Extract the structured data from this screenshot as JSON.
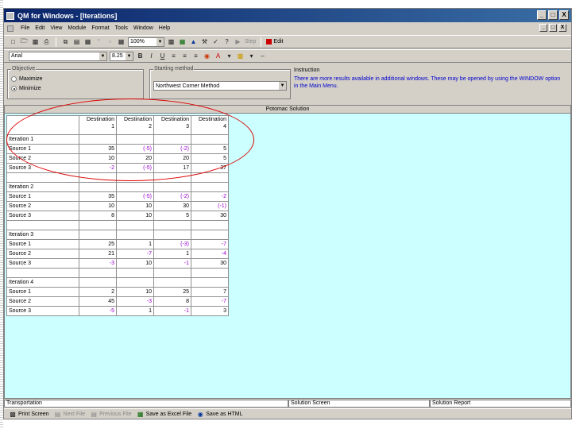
{
  "window": {
    "title": "QM for Windows - [Iterations]",
    "controls": [
      "_",
      "□",
      "X"
    ],
    "mdi_controls": [
      "_",
      "□",
      "X"
    ]
  },
  "menu": [
    "File",
    "Edit",
    "View",
    "Module",
    "Format",
    "Tools",
    "Window",
    "Help"
  ],
  "toolbar1": {
    "zoom_value": "100%",
    "step_label": "Step",
    "edit_label": "Edit"
  },
  "toolbar2": {
    "font_name": "Arial",
    "font_size": "8.25"
  },
  "options": {
    "objective_legend": "Objective",
    "maximize_label": "Maximize",
    "minimize_label": "Minimize",
    "selected_objective": "Minimize",
    "starting_method_legend": "Starting method",
    "starting_method_value": "Northwest Corner Method",
    "instruction_label": "Instruction",
    "instruction_text": "There are more results available in additional windows. These may be opened by using the WINDOW option in the Main Menu."
  },
  "grid": {
    "title": "Potomac Solution",
    "columns": [
      {
        "line1": "Destination",
        "line2": "1"
      },
      {
        "line1": "Destination",
        "line2": "2"
      },
      {
        "line1": "Destination",
        "line2": "3"
      },
      {
        "line1": "Destination",
        "line2": "4"
      }
    ],
    "iterations": [
      {
        "label": "Iteration 1",
        "rows": [
          {
            "label": "Source 1",
            "values": [
              "35",
              "(-5)",
              "(-2)",
              "5"
            ]
          },
          {
            "label": "Source 2",
            "values": [
              "10",
              "20",
              "20",
              "5"
            ]
          },
          {
            "label": "Source 3",
            "values": [
              "-2",
              "(-5)",
              "17",
              "37"
            ]
          }
        ]
      },
      {
        "label": "Iteration 2",
        "rows": [
          {
            "label": "Source 1",
            "values": [
              "35",
              "(-5)",
              "(-2)",
              "-2"
            ]
          },
          {
            "label": "Source 2",
            "values": [
              "10",
              "10",
              "30",
              "(-1)"
            ]
          },
          {
            "label": "Source 3",
            "values": [
              "8",
              "10",
              "5",
              "30"
            ]
          }
        ]
      },
      {
        "label": "Iteration 3",
        "rows": [
          {
            "label": "Source 1",
            "values": [
              "25",
              "1",
              "(-3)",
              "-7"
            ]
          },
          {
            "label": "Source 2",
            "values": [
              "21",
              "-7",
              "1",
              "-4"
            ]
          },
          {
            "label": "Source 3",
            "values": [
              "-3",
              "10",
              "-1",
              "30"
            ]
          }
        ]
      },
      {
        "label": "Iteration 4",
        "rows": [
          {
            "label": "Source 1",
            "values": [
              "2",
              "10",
              "25",
              "7"
            ]
          },
          {
            "label": "Source 2",
            "values": [
              "45",
              "-3",
              "8",
              "-7"
            ]
          },
          {
            "label": "Source 3",
            "values": [
              "-5",
              "1",
              "-1",
              "3"
            ]
          }
        ]
      }
    ]
  },
  "bottom_panes": [
    "Transportation",
    "Solution Screen",
    "Solution Report"
  ],
  "statusbar": {
    "print_screen": "Print Screen",
    "next_file": "Next File",
    "previous_file": "Previous File",
    "save_excel": "Save as Excel File",
    "save_html": "Save as HTML"
  },
  "colors": {
    "negative_value": "#9900cc",
    "highlight_oval": "#dd0000",
    "grid_background": "#ccffff",
    "instruction_text": "#0000cc"
  }
}
